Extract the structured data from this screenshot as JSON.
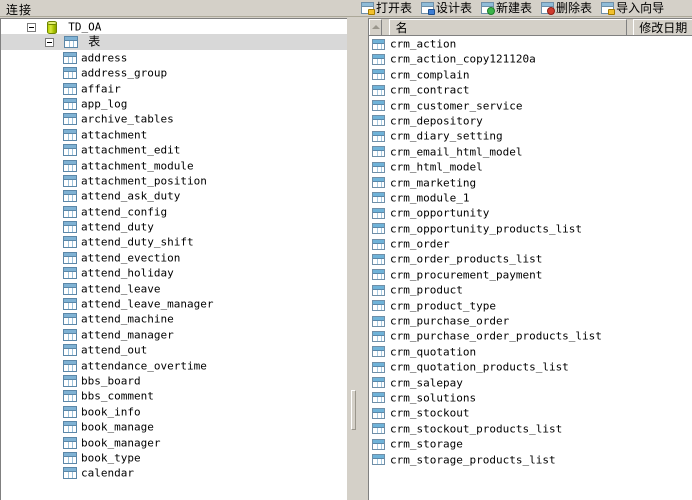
{
  "left_panel": {
    "header_label": "连接",
    "tree": {
      "database_node": {
        "label": "TD_OA",
        "icon": "database-icon",
        "expanded": true
      },
      "tables_node": {
        "label": "表",
        "icon": "table-folder-icon",
        "expanded": true,
        "selected": true
      },
      "tables": [
        "address",
        "address_group",
        "affair",
        "app_log",
        "archive_tables",
        "attachment",
        "attachment_edit",
        "attachment_module",
        "attachment_position",
        "attend_ask_duty",
        "attend_config",
        "attend_duty",
        "attend_duty_shift",
        "attend_evection",
        "attend_holiday",
        "attend_leave",
        "attend_leave_manager",
        "attend_machine",
        "attend_manager",
        "attend_out",
        "attendance_overtime",
        "bbs_board",
        "bbs_comment",
        "book_info",
        "book_manage",
        "book_manager",
        "book_type",
        "calendar"
      ]
    },
    "scrollbar": {
      "up_arrow": "scroll-up-arrow"
    }
  },
  "right_panel": {
    "toolbar": [
      {
        "label": "打开表",
        "icon": "open-table-icon",
        "overlay": "open"
      },
      {
        "label": "设计表",
        "icon": "design-table-icon",
        "overlay": "design"
      },
      {
        "label": "新建表",
        "icon": "new-table-icon",
        "overlay": "new"
      },
      {
        "label": "删除表",
        "icon": "delete-table-icon",
        "overlay": "del"
      },
      {
        "label": "导入向导",
        "icon": "import-wizard-icon",
        "overlay": "import"
      }
    ],
    "columns": [
      {
        "key": "name",
        "label": "名"
      },
      {
        "key": "modified",
        "label": "修改日期"
      }
    ],
    "rows": [
      "crm_action",
      "crm_action_copy121120a",
      "crm_complain",
      "crm_contract",
      "crm_customer_service",
      "crm_depository",
      "crm_diary_setting",
      "crm_email_html_model",
      "crm_html_model",
      "crm_marketing",
      "crm_module_1",
      "crm_opportunity",
      "crm_opportunity_products_list",
      "crm_order",
      "crm_order_products_list",
      "crm_procurement_payment",
      "crm_product",
      "crm_product_type",
      "crm_purchase_order",
      "crm_purchase_order_products_list",
      "crm_quotation",
      "crm_quotation_products_list",
      "crm_salepay",
      "crm_solutions",
      "crm_stockout",
      "crm_stockout_products_list",
      "crm_storage",
      "crm_storage_products_list"
    ]
  },
  "colors": {
    "window_bg": "#d4d0c8",
    "list_bg": "#ffffff",
    "selection": "#d8d8d8",
    "table_icon": "#6fb3d9",
    "db_icon": "#b9d200"
  }
}
